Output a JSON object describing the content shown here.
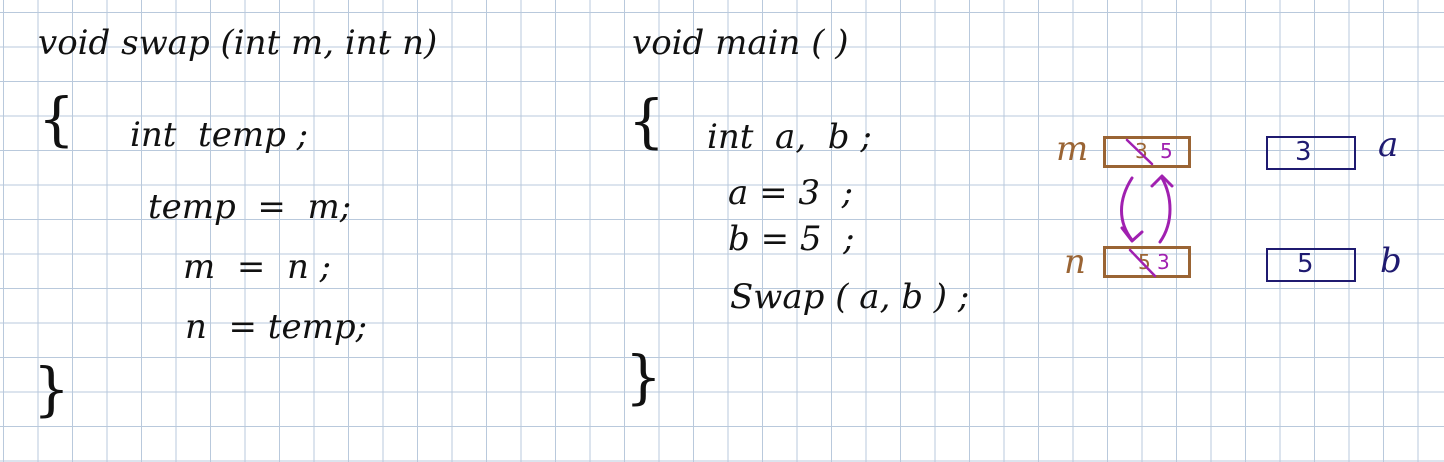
{
  "swap_function": {
    "signature": "void swap (int m, int n)",
    "open_brace": "{",
    "lines": [
      "int  temp ;",
      "temp  =  m;",
      "m  =  n ;",
      "n  = temp;"
    ],
    "close_brace": "}"
  },
  "main_function": {
    "signature": "void main ( )",
    "open_brace": "{",
    "lines": [
      "int  a,  b ;",
      "a = 3  ;",
      "b = 5  ;",
      "Swap ( a, b ) ;"
    ],
    "close_brace": "}"
  },
  "memory_diagram": {
    "swap_vars": [
      {
        "name": "m",
        "old_value": "3",
        "new_value": "5"
      },
      {
        "name": "n",
        "old_value": "5",
        "new_value": "3"
      }
    ],
    "main_vars": [
      {
        "name": "a",
        "value": "3"
      },
      {
        "name": "b",
        "value": "5"
      }
    ],
    "colors": {
      "swap_vars": "#9a6434",
      "main_vars": "#1f1a70",
      "arrows_and_edits": "#a020b0",
      "grid": "#b9c9dc"
    }
  }
}
